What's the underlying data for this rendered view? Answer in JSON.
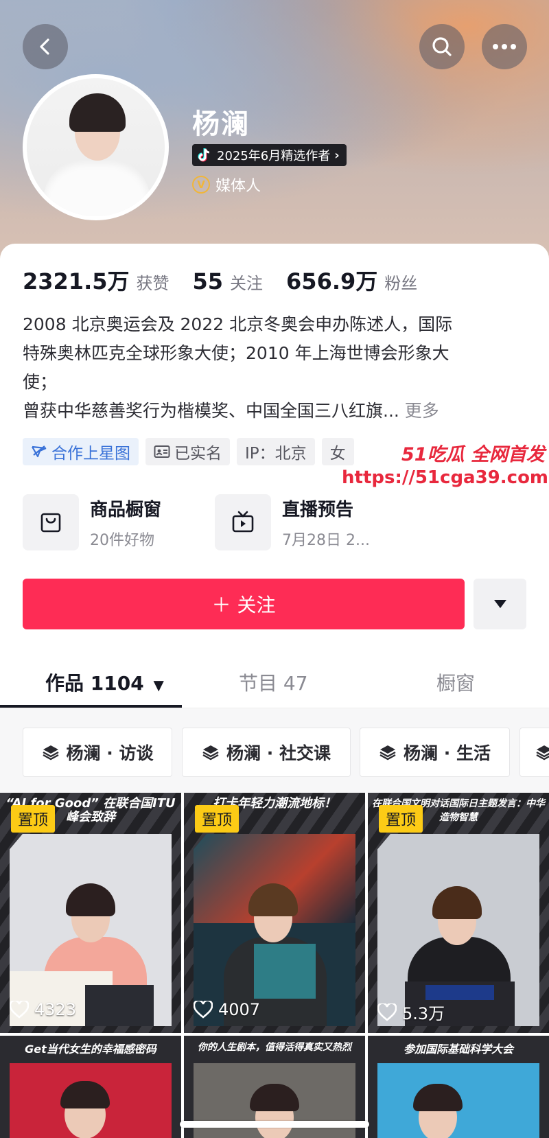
{
  "profile": {
    "name": "杨澜",
    "creator_badge": "2025年6月精选作者",
    "role": "媒体人",
    "role_badge_letter": "V",
    "accent_color": "#fe2c55"
  },
  "stats": [
    {
      "value": "2321.5万",
      "label": "获赞"
    },
    {
      "value": "55",
      "label": "关注"
    },
    {
      "value": "656.9万",
      "label": "粉丝"
    }
  ],
  "bio": {
    "line1": "2008 北京奥运会及 2022 北京冬奥会申办陈述人，国际",
    "line2": "特殊奥林匹克全球形象大使；2010 年上海世博会形象大",
    "line3": "使；",
    "line4": "曾获中华慈善奖行为楷模奖、中国全国三八红旗...",
    "more": "更多"
  },
  "tags": [
    {
      "label": "合作上星图",
      "icon": "star-map-icon"
    },
    {
      "label": "已实名",
      "icon": "id-card-icon"
    },
    {
      "label": "IP：北京"
    },
    {
      "label": "女"
    }
  ],
  "watermark": {
    "line1": "51吃瓜 全网首发",
    "line2": "https://51cga39.com"
  },
  "shortcuts": [
    {
      "title": "商品橱窗",
      "sub": "20件好物",
      "icon": "shopping-bag-icon"
    },
    {
      "title": "直播预告",
      "sub": "7月28日 2...",
      "icon": "live-tv-icon"
    }
  ],
  "follow_button": "＋ 关注",
  "tabs": [
    {
      "label": "作品 1104",
      "active": true
    },
    {
      "label": "节目 47"
    },
    {
      "label": "橱窗"
    }
  ],
  "collections": [
    {
      "label": "杨澜 · 访谈"
    },
    {
      "label": "杨澜 · 社交课"
    },
    {
      "label": "杨澜 · 生活"
    }
  ],
  "videos": [
    {
      "caption": "“AI for Good” 在联合国ITU峰会致辞",
      "pin": "置顶",
      "likes": "4323"
    },
    {
      "caption": "打卡年轻力潮流地标！",
      "pin": "置顶",
      "likes": "4007"
    },
    {
      "caption": "在联合国文明对话国际日主题发言：中华造物智慧",
      "pin": "置顶",
      "likes": "5.3万"
    }
  ],
  "videos_row2": [
    {
      "caption": "Get当代女生的幸福感密码"
    },
    {
      "caption": "你的人生剧本，值得活得真实又热烈"
    },
    {
      "caption": "参加国际基础科学大会"
    }
  ]
}
